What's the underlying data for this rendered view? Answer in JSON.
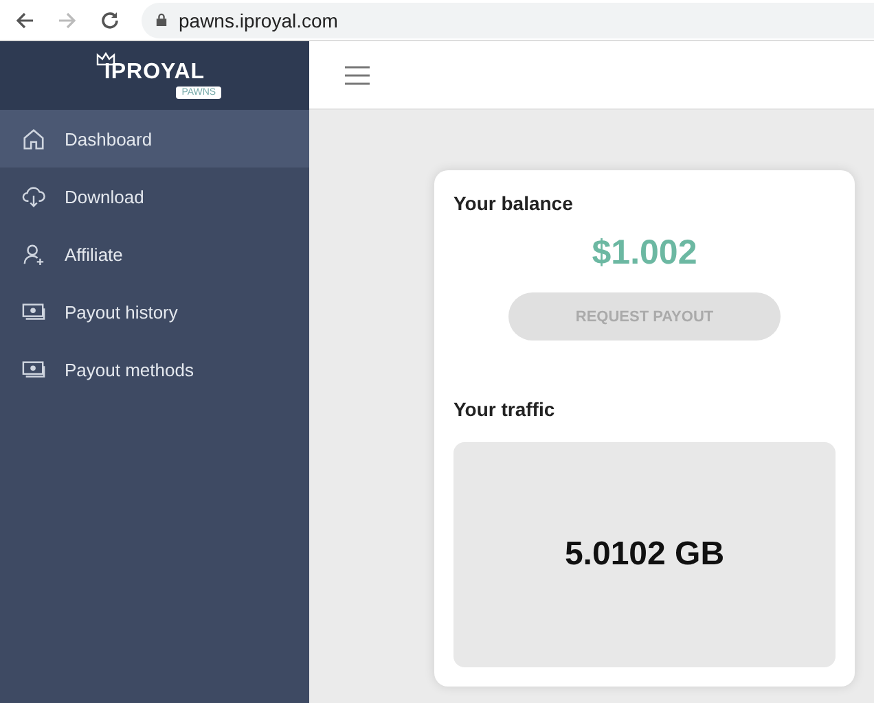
{
  "browser": {
    "url": "pawns.iproyal.com"
  },
  "logo": {
    "name": "IPROYAL",
    "badge": "PAWNS"
  },
  "sidebar": {
    "items": [
      {
        "label": "Dashboard",
        "selected": true
      },
      {
        "label": "Download",
        "selected": false
      },
      {
        "label": "Affiliate",
        "selected": false
      },
      {
        "label": "Payout history",
        "selected": false
      },
      {
        "label": "Payout methods",
        "selected": false
      }
    ]
  },
  "balance": {
    "title": "Your balance",
    "amount": "$1.002",
    "button": {
      "label": "REQUEST PAYOUT",
      "disabled": true
    }
  },
  "traffic": {
    "title": "Your traffic",
    "value": "5.0102 GB"
  }
}
